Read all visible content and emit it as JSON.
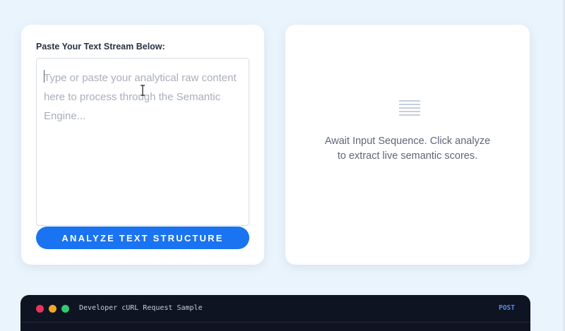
{
  "input_card": {
    "label": "Paste Your Text Stream Below:",
    "placeholder": "Type or paste your analytical raw content here to process through the Semantic Engine...",
    "value": "",
    "analyze_button": "ANALYZE TEXT STRUCTURE"
  },
  "output_card": {
    "icon": "document-lines-icon",
    "message": "Await Input Sequence. Click analyze to extract live semantic scores."
  },
  "developer_panel": {
    "title": "Developer cURL Request Sample",
    "method": "POST"
  },
  "colors": {
    "background": "#eaf4fc",
    "accent": "#1a73f0",
    "terminal": "#0f1422",
    "dot_red": "#e9355b",
    "dot_yellow": "#f5a623",
    "dot_green": "#2ecc71"
  }
}
